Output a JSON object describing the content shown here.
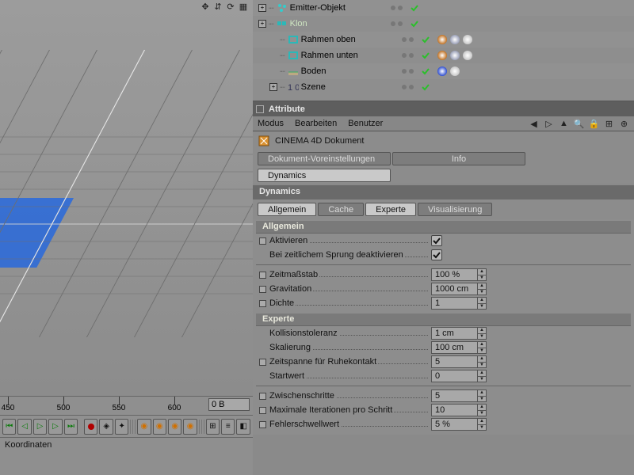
{
  "viewport": {
    "ruler_labels": [
      "450",
      "500",
      "550",
      "600"
    ],
    "ruler_field": "0 B"
  },
  "coords": {
    "title": "Koordinaten"
  },
  "object_manager": {
    "items": [
      {
        "name": "Emitter-Objekt",
        "expandable": true,
        "selected": false
      },
      {
        "name": "Klon",
        "expandable": true,
        "selected": true
      },
      {
        "name": "Rahmen oben",
        "expandable": false,
        "selected": false,
        "tags": true
      },
      {
        "name": "Rahmen unten",
        "expandable": false,
        "selected": false,
        "tags": true
      },
      {
        "name": "Boden",
        "expandable": false,
        "selected": false,
        "tags_single": true
      },
      {
        "name": "Szene",
        "expandable": true,
        "selected": false
      }
    ]
  },
  "attribute": {
    "header": "Attribute",
    "menu": [
      "Modus",
      "Bearbeiten",
      "Benutzer"
    ],
    "doc_title": "CINEMA 4D Dokument",
    "tabs1": [
      {
        "label": "Dokument-Voreinstellungen",
        "active": false
      },
      {
        "label": "Info",
        "active": false
      }
    ],
    "tabs1b": [
      {
        "label": "Dynamics",
        "active": true
      }
    ],
    "section_title": "Dynamics",
    "tabs2": [
      {
        "label": "Allgemein",
        "active": true
      },
      {
        "label": "Cache",
        "active": false
      },
      {
        "label": "Experte",
        "active": true
      },
      {
        "label": "Visualisierung",
        "active": false
      }
    ],
    "group_allgemein": {
      "title": "Allgemein",
      "rows": [
        {
          "label": "Aktivieren",
          "type": "check",
          "checked": true,
          "toggle": true
        },
        {
          "label": "Bei zeitlichem Sprung deaktivieren",
          "type": "check",
          "checked": true,
          "toggle": false
        },
        {
          "label": "Zeitmaßstab",
          "type": "field",
          "value": "100 %"
        },
        {
          "label": "Gravitation",
          "type": "field",
          "value": "1000 cm"
        },
        {
          "label": "Dichte",
          "type": "field",
          "value": "1"
        }
      ]
    },
    "group_experte": {
      "title": "Experte",
      "rows": [
        {
          "label": "Kollisionstoleranz",
          "type": "field",
          "value": "1 cm",
          "toggle": false
        },
        {
          "label": "Skalierung",
          "type": "field",
          "value": "100 cm",
          "toggle": false
        },
        {
          "label": "Zeitspanne für Ruhekontakt",
          "type": "field",
          "value": "5",
          "toggle": true
        },
        {
          "label": "Startwert",
          "type": "field",
          "value": "0",
          "toggle": false
        },
        {
          "label": "Zwischenschritte",
          "type": "field",
          "value": "5",
          "toggle": true
        },
        {
          "label": "Maximale Iterationen pro Schritt",
          "type": "field",
          "value": "10",
          "toggle": true
        },
        {
          "label": "Fehlerschwellwert",
          "type": "field",
          "value": "5 %",
          "toggle": true
        }
      ]
    }
  }
}
